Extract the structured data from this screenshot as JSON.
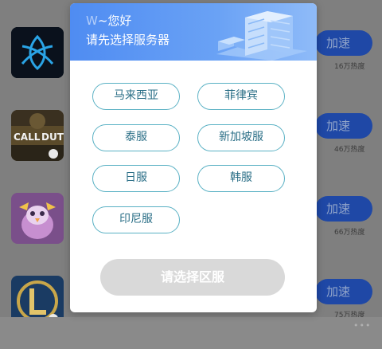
{
  "background": {
    "games": [
      {
        "name": "Battle.net",
        "icon": "battlenet-game-icon",
        "action": "加速",
        "count": "16万热度"
      },
      {
        "name": "Call of Duty",
        "icon": "call-of-duty-game-icon",
        "icon_text_1": "CALL",
        "icon_text_2": "DUTY",
        "action": "加速",
        "count": "46万热度"
      },
      {
        "name": "Mobile battle game",
        "icon": "penguin-game-icon",
        "action": "加速",
        "count": "66万热度"
      },
      {
        "name": "League of Legends",
        "icon": "league-game-icon",
        "action": "加速",
        "count": "75万热度"
      }
    ],
    "watermark": "•••"
  },
  "modal": {
    "greeting_user": "W",
    "greeting_text": "~您好",
    "subtitle": "请先选择服务器",
    "header_colors": {
      "start": "#4f8cf2",
      "end": "#8fbbf8"
    },
    "servers": [
      {
        "label": "马来西亚"
      },
      {
        "label": "菲律宾"
      },
      {
        "label": "泰服"
      },
      {
        "label": "新加坡服"
      },
      {
        "label": "日服"
      },
      {
        "label": "韩服"
      },
      {
        "label": "印尼服"
      }
    ],
    "option_border_color": "#5ab1c4",
    "confirm_label": "请选择区服",
    "confirm_disabled_color": "#d9d9d9"
  }
}
